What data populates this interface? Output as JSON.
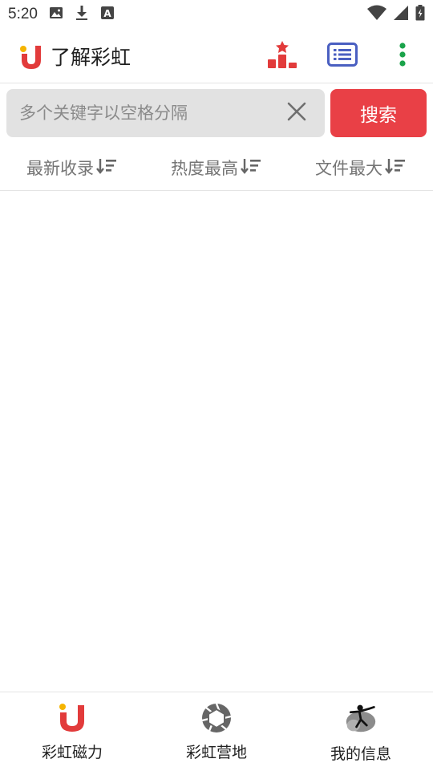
{
  "status_bar": {
    "time": "5:20",
    "icons": [
      "image-icon",
      "download-icon",
      "font-a-icon",
      "wifi-icon",
      "signal-icon",
      "battery-icon"
    ]
  },
  "app_bar": {
    "title": "了解彩虹",
    "logo": "magnet-logo-icon",
    "actions": [
      "ranking-icon",
      "list-icon",
      "more-vert-icon"
    ]
  },
  "search": {
    "placeholder": "多个关键字以空格分隔",
    "value": "",
    "button_label": "搜索"
  },
  "sort_tabs": [
    {
      "label": "最新收录",
      "icon": "sort-desc-icon"
    },
    {
      "label": "热度最高",
      "icon": "sort-desc-icon"
    },
    {
      "label": "文件最大",
      "icon": "sort-desc-icon"
    }
  ],
  "bottom_nav": [
    {
      "label": "彩虹磁力",
      "icon": "magnet-icon"
    },
    {
      "label": "彩虹营地",
      "icon": "aperture-icon"
    },
    {
      "label": "我的信息",
      "icon": "user-avatar-icon"
    }
  ],
  "colors": {
    "accent_red": "#e94046",
    "ranking_red": "#e23b3b",
    "list_blue": "#4a5fc1",
    "menu_green": "#1aa34a",
    "magnet_yellow": "#f5b400"
  }
}
